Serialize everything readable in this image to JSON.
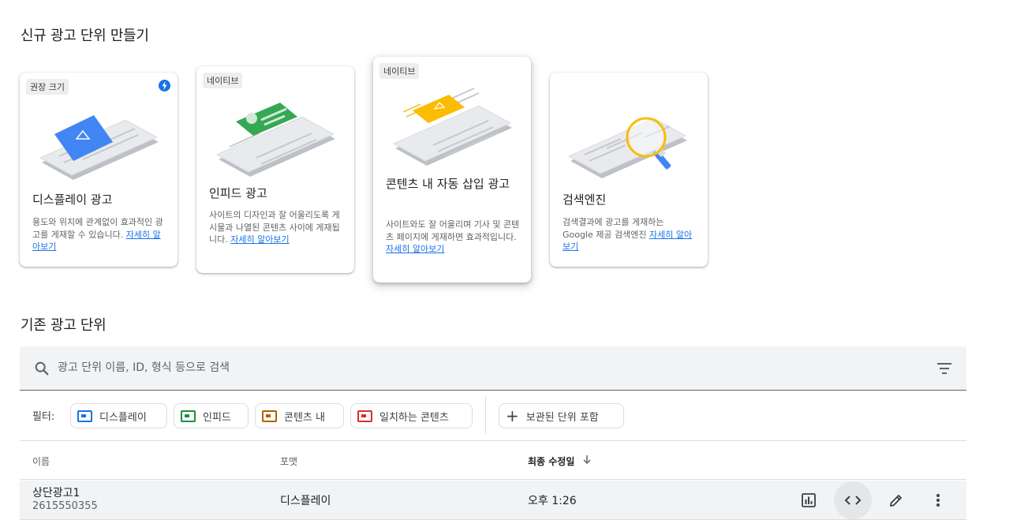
{
  "create_section": {
    "title": "신규 광고 단위 만들기"
  },
  "cards": [
    {
      "tag": "권장 크기",
      "title": "디스플레이 광고",
      "desc": "용도와 위치에 관계없이 효과적인 광고를 게재할 수 있습니다. ",
      "link": "자세히 알아보기",
      "accent": "#4285f4"
    },
    {
      "tag": "네이티브",
      "title": "인피드 광고",
      "desc": "사이트의 디자인과 잘 어울리도록 게시물과 나열된 콘텐츠 사이에 게재됩니다. ",
      "link": "자세히 알아보기",
      "accent": "#34a853"
    },
    {
      "tag": "네이티브",
      "title": "콘텐츠 내 자동 삽입 광고",
      "desc": "사이트와도 잘 어울리며 기사 및 콘텐츠 페이지에 게재하면 효과적입니다. ",
      "link": "자세히 알아보기",
      "accent": "#fbbc04"
    },
    {
      "tag": "",
      "title": "검색엔진",
      "desc": "검색결과에 광고를 게재하는 Google 제공 검색엔진 ",
      "link": "자세히 알아보기",
      "accent": "#fbbc04"
    }
  ],
  "existing_section": {
    "title": "기존 광고 단위"
  },
  "search": {
    "placeholder": "광고 단위 이름, ID, 형식 등으로 검색"
  },
  "filters": {
    "label": "필터:",
    "chips": [
      {
        "label": "디스플레이",
        "color": "#1a73e8"
      },
      {
        "label": "인피드",
        "color": "#1e8e3e"
      },
      {
        "label": "콘텐츠 내",
        "color": "#b06000"
      },
      {
        "label": "일치하는 콘텐츠",
        "color": "#d93025"
      }
    ],
    "archived_label": "보관된 단위 포함"
  },
  "table": {
    "columns": {
      "name": "이름",
      "format": "포맷",
      "modified": "최종 수정일",
      "sort_icon": "arrow-down-icon"
    },
    "rows": [
      {
        "name": "상단광고1",
        "id": "2615550355",
        "format": "디스플레이",
        "modified": "오후 1:26"
      }
    ]
  }
}
